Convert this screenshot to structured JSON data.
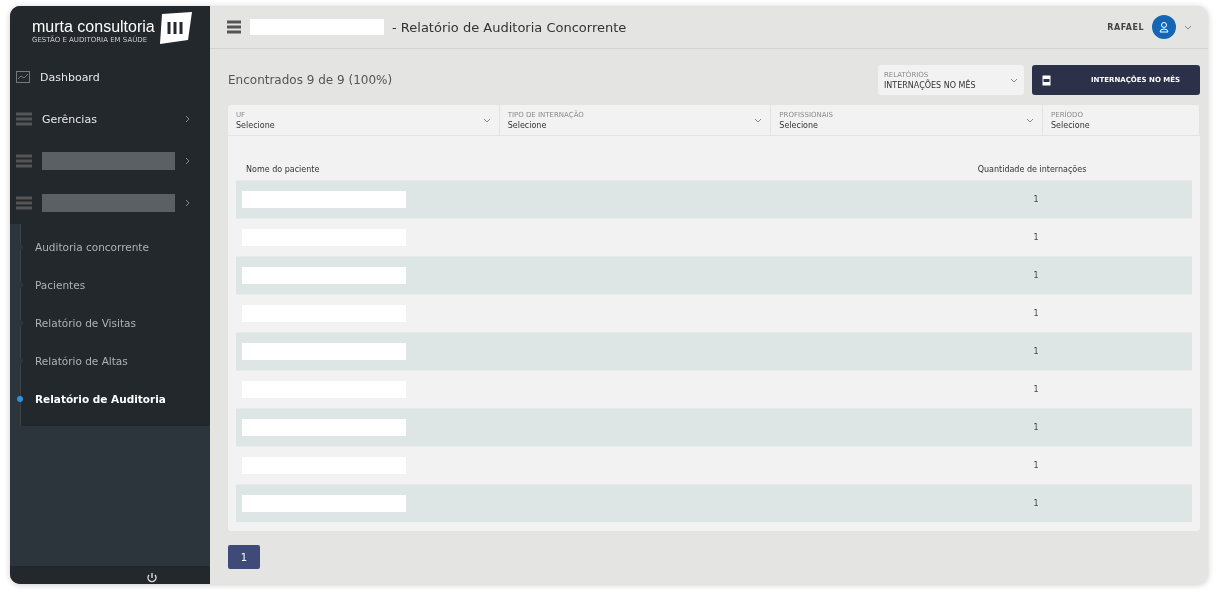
{
  "brand": {
    "name": "murta consultoria",
    "tagline": "GESTÃO E AUDITORIA EM SAÚDE"
  },
  "sidebar": {
    "items": [
      {
        "label": "Dashboard",
        "kind": "link",
        "redacted": false
      },
      {
        "label": "Gerências",
        "kind": "group",
        "redacted": false
      },
      {
        "kind": "group",
        "redacted": true
      },
      {
        "kind": "group",
        "redacted": true
      }
    ],
    "subitems": [
      {
        "label": "Auditoria concorrente",
        "selected": false
      },
      {
        "label": "Pacientes",
        "selected": false
      },
      {
        "label": "Relatório de Visitas",
        "selected": false
      },
      {
        "label": "Relatório de Altas",
        "selected": false
      },
      {
        "label": "Relatório de Auditoria",
        "selected": true
      }
    ]
  },
  "header": {
    "title": "- Relatório de Auditoria Concorrente",
    "user": "RAFAEL"
  },
  "summary": "Encontrados 9 de 9 (100%)",
  "report_select": {
    "label": "RELATÓRIOS",
    "value": "INTERNAÇÕES NO MÊS"
  },
  "export_button": "INTERNAÇÕES NO MÊS",
  "filters": [
    {
      "label": "UF",
      "value": "Selecione",
      "dropdown": true
    },
    {
      "label": "TIPO DE INTERNAÇÃO",
      "value": "Selecione",
      "dropdown": true
    },
    {
      "label": "PROFISSIONAIS",
      "value": "Selecione",
      "dropdown": true
    },
    {
      "label": "PERÍODO",
      "value": "Selecione",
      "dropdown": false
    }
  ],
  "table": {
    "columns": [
      "Nome do paciente",
      "Quantidade de internações"
    ],
    "rows": [
      {
        "count": "1"
      },
      {
        "count": "1"
      },
      {
        "count": "1"
      },
      {
        "count": "1"
      },
      {
        "count": "1"
      },
      {
        "count": "1"
      },
      {
        "count": "1"
      },
      {
        "count": "1"
      },
      {
        "count": "1"
      }
    ]
  },
  "pagination": [
    {
      "label": "1",
      "selected": true
    }
  ]
}
